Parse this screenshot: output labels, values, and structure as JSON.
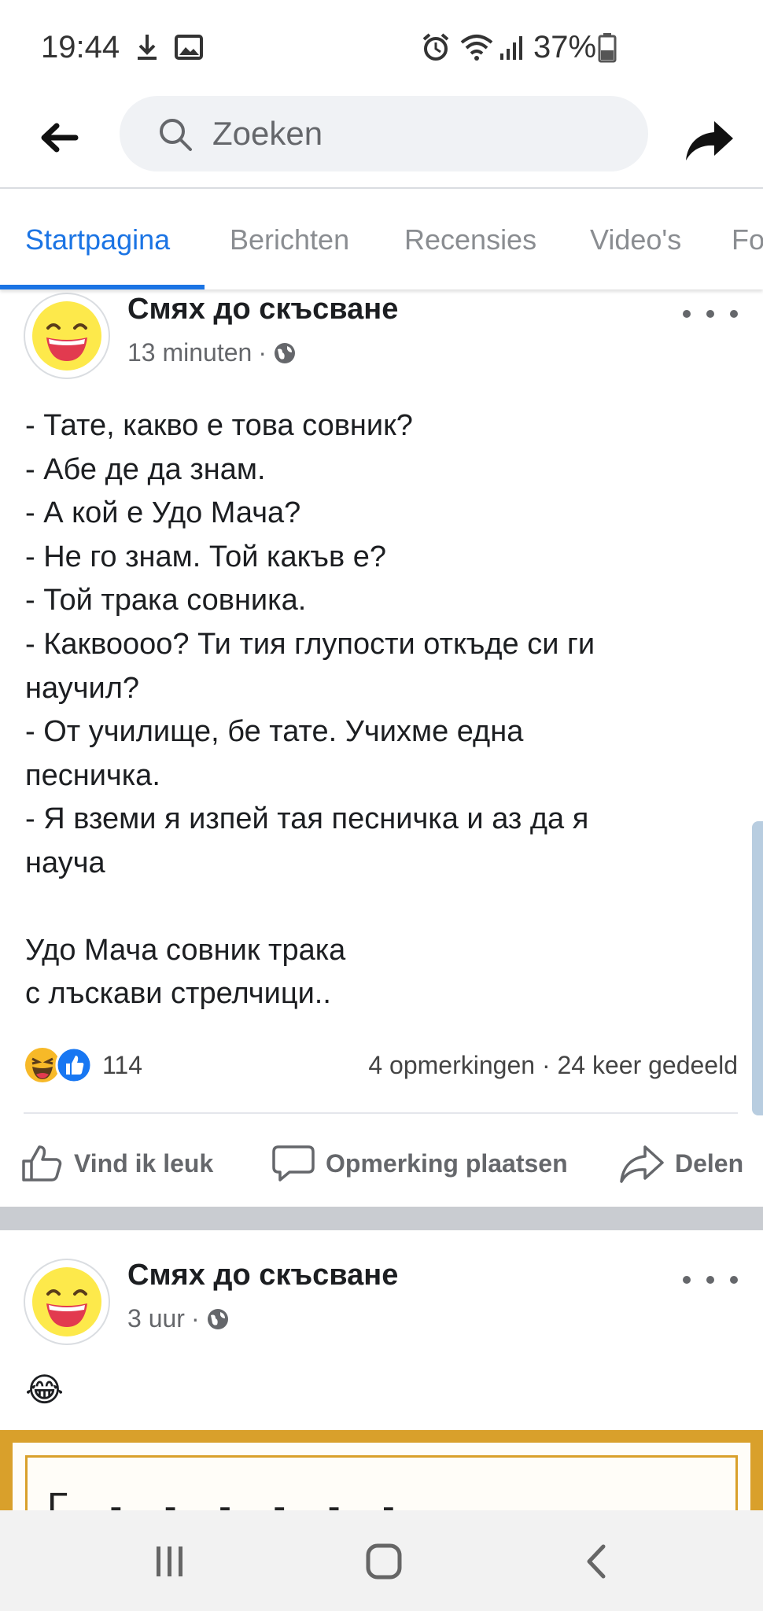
{
  "status_bar": {
    "time": "19:44",
    "battery": "37%",
    "icons": [
      "download-icon",
      "image-icon",
      "alarm-icon",
      "wifi-icon",
      "signal-icon",
      "battery-icon"
    ]
  },
  "appbar": {
    "back_icon": "arrow-left-icon",
    "search_placeholder": "Zoeken",
    "share_icon": "share-arrow-icon"
  },
  "tabs": [
    {
      "label": "Startpagina",
      "active": true
    },
    {
      "label": "Berichten"
    },
    {
      "label": "Recensies"
    },
    {
      "label": "Video's"
    },
    {
      "label": "Fo"
    }
  ],
  "accent_color": "#1b74e4",
  "post1": {
    "author": "Смях до скъсване",
    "time": "13 minuten",
    "separator": "·",
    "lines": [
      "- Тате, какво е това совник?",
      "- Абе де да знам.",
      "- А кой е Удо Мача?",
      "- Не го знам. Той какъв е?",
      "- Той трака совника.",
      "- Каквоооо? Ти тия глупости откъде си ги",
      "научил?",
      "- От училище, бе тате. Учихме една",
      "песничка.",
      "- Я вземи я изпей тая песничка и аз да я",
      "науча",
      "",
      "Удо Мача совник трака",
      "с лъскави стрелчици.."
    ],
    "reaction_count": "114",
    "comments": "4 opmerkingen",
    "shares": "24 keer gedeeld",
    "actions": {
      "like": "Vind ik leuk",
      "comment": "Opmerking plaatsen",
      "share": "Delen"
    }
  },
  "post2": {
    "author": "Смях до скъсване",
    "time": "3 uur",
    "separator": "·",
    "emoji": "😂",
    "image_text": "Г - - - - - -"
  },
  "navbar": {
    "icons": [
      "recent-apps-icon",
      "home-icon",
      "back-nav-icon"
    ]
  }
}
